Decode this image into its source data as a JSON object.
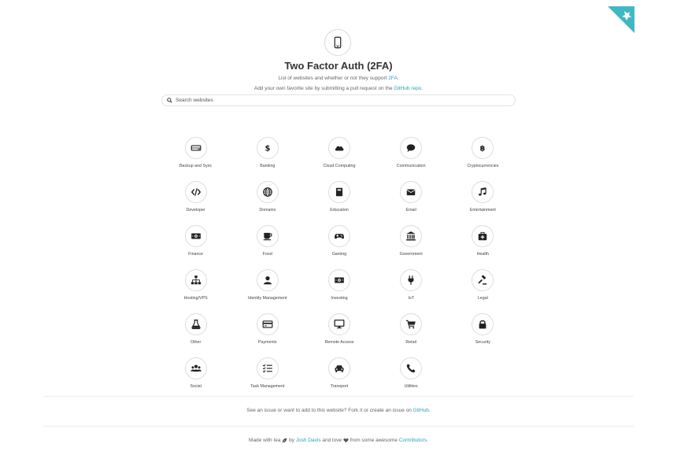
{
  "header": {
    "title": "Two Factor Auth (2FA)",
    "subtitle_prefix": "List of websites and whether or not they support ",
    "subtitle_link": "2FA",
    "subtitle_suffix": ".",
    "contribute_prefix": "Add your own favorite site by submitting a pull request on the ",
    "contribute_link": "GitHub repo",
    "contribute_suffix": ".",
    "hero_icon": "mobile-phone-icon",
    "corner_icon": "github-corner-icon"
  },
  "search": {
    "placeholder": "Search websites",
    "value": ""
  },
  "categories": [
    {
      "label": "Backup and Sync",
      "icon": "hard-drive-icon"
    },
    {
      "label": "Banking",
      "icon": "dollar-icon"
    },
    {
      "label": "Cloud Computing",
      "icon": "cloud-icon"
    },
    {
      "label": "Communication",
      "icon": "speech-bubble-icon"
    },
    {
      "label": "Cryptocurrencies",
      "icon": "bitcoin-icon"
    },
    {
      "label": "Developer",
      "icon": "code-icon"
    },
    {
      "label": "Domains",
      "icon": "globe-icon"
    },
    {
      "label": "Education",
      "icon": "book-icon"
    },
    {
      "label": "Email",
      "icon": "envelope-icon"
    },
    {
      "label": "Entertainment",
      "icon": "music-note-icon"
    },
    {
      "label": "Finance",
      "icon": "money-icon"
    },
    {
      "label": "Food",
      "icon": "coffee-cup-icon"
    },
    {
      "label": "Gaming",
      "icon": "gamepad-icon"
    },
    {
      "label": "Government",
      "icon": "institution-icon"
    },
    {
      "label": "Health",
      "icon": "medkit-icon"
    },
    {
      "label": "Hosting/VPS",
      "icon": "sitemap-icon"
    },
    {
      "label": "Identity Management",
      "icon": "user-icon"
    },
    {
      "label": "Investing",
      "icon": "money-icon"
    },
    {
      "label": "IoT",
      "icon": "plug-icon"
    },
    {
      "label": "Legal",
      "icon": "gavel-icon"
    },
    {
      "label": "Other",
      "icon": "flask-icon"
    },
    {
      "label": "Payments",
      "icon": "credit-card-icon"
    },
    {
      "label": "Remote Access",
      "icon": "desktop-icon"
    },
    {
      "label": "Retail",
      "icon": "shopping-cart-icon"
    },
    {
      "label": "Security",
      "icon": "lock-icon"
    },
    {
      "label": "Social",
      "icon": "users-icon"
    },
    {
      "label": "Task Management",
      "icon": "tasks-icon"
    },
    {
      "label": "Transport",
      "icon": "car-icon"
    },
    {
      "label": "Utilities",
      "icon": "phone-icon"
    }
  ],
  "footer": {
    "issue_prefix": "See an issue or want to add to this website? Fork it or create an issue on ",
    "issue_link": "GitHub",
    "issue_suffix": ".",
    "made_prefix": "Made with tea",
    "made_tea_icon": "leaf-icon",
    "made_by": " by ",
    "author_link": "Josh Davis",
    "made_love": " and love",
    "love_icon": "heart-icon",
    "made_from": " from some awesome ",
    "contributors_link": "Contributors",
    "made_suffix": "."
  },
  "colors": {
    "link": "#2a9fbf",
    "corner": "#3fb8c4",
    "icon": "#222222"
  }
}
